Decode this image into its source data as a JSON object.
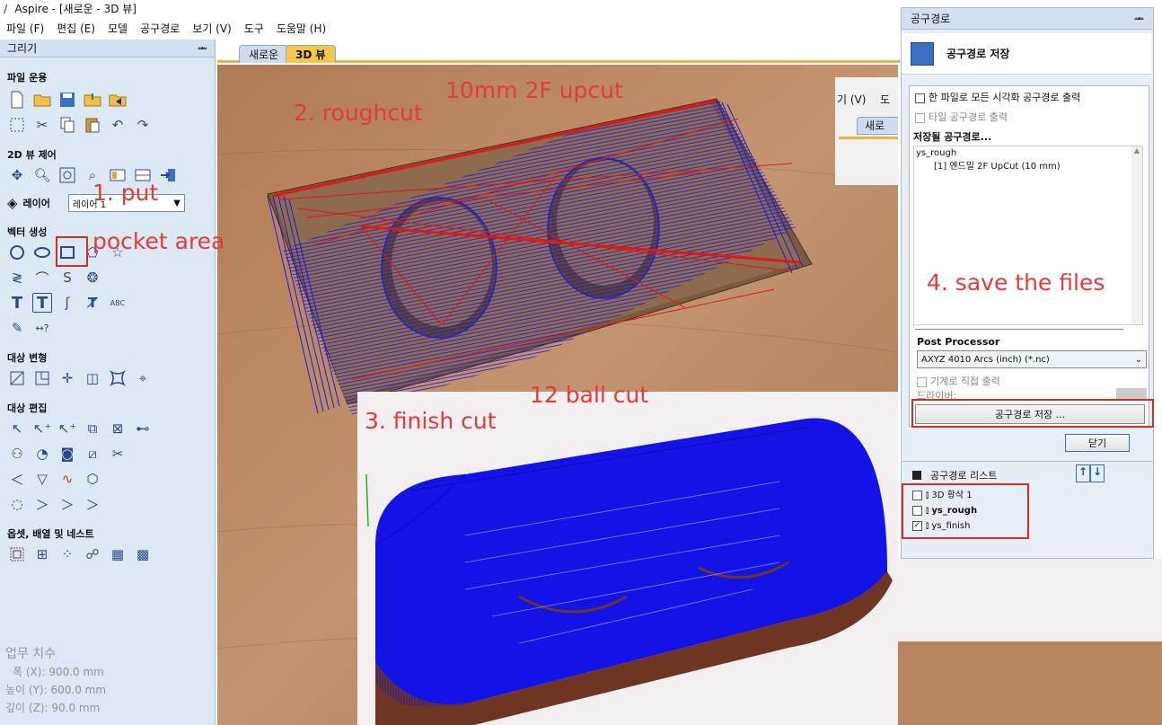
{
  "window": {
    "title": "Aspire - [새로운 - 3D 뷰]"
  },
  "menu": [
    "파일 (F)",
    "편집 (E)",
    "모델",
    "공구경로",
    "보기 (V)",
    "도구",
    "도움말 (H)"
  ],
  "left_panel": {
    "title": "그리기",
    "pin": "ᆂ",
    "sections": {
      "file_ops": "파일 운용",
      "view2d": "2D 뷰 제어",
      "vector_create": "벡터 생성",
      "transform": "대상 변형",
      "edit": "대상 편집",
      "offset": "옵셋, 배열 및 네스트"
    },
    "layer_label": "레이어",
    "layer_value": "레이어 1",
    "dims": {
      "header": "업무 치수",
      "width_label": "폭 (X):",
      "width": "900.0 mm",
      "height_label": "높이 (Y):",
      "height": "600.0 mm",
      "depth_label": "깊이 (Z):",
      "depth": "90.0 mm"
    }
  },
  "tabs": [
    {
      "label": "새로운"
    },
    {
      "label": "3D 뷰"
    }
  ],
  "annotations": {
    "step1_a": "1. put",
    "step1_b": "pocket area",
    "step2": "2. roughcut",
    "tool1": "10mm 2F upcut",
    "step3": "3. finish cut",
    "tool2": "12 ball cut",
    "step4": "4. save the files"
  },
  "background_window": {
    "menu_frag1": "기 (V)",
    "menu_frag2": "도",
    "tab_frag": "새로"
  },
  "right_panel": {
    "title": "공구경로",
    "pin": "ᆂ",
    "header": "공구경로 저장",
    "opt_all": "한 파일로 모든 시각화 공구경로 출력",
    "opt_tile": "타일 공구경로 출력",
    "saved_label": "저장될 공구경로...",
    "saved_group": "ys_rough",
    "saved_item": "[1] 엔드밀 2F UpCut (10 mm)",
    "post_label": "Post Processor",
    "post_value": "AXYZ 4010 Arcs (inch) (*.nc)",
    "direct_output": "기계로 직접 출력",
    "driver_label": "드라이버:",
    "save_btn": "공구경로 저장 ...",
    "close_btn": "닫기",
    "list_title": "공구경로 리스트",
    "list": [
      {
        "name": "3D 황삭 1",
        "checked": false
      },
      {
        "name": "ys_rough",
        "checked": false
      },
      {
        "name": "ys_finish",
        "checked": true
      }
    ]
  },
  "colors": {
    "accent": "#e0b845",
    "annotation": "#e33b3b",
    "toolpath": "#1414e6",
    "panel": "#dde8f5"
  }
}
